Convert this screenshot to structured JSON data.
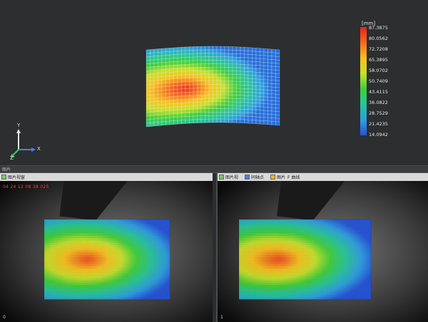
{
  "colorbar": {
    "unit": "[mm]",
    "ticks": [
      "87.3875",
      "80.0562",
      "72.7208",
      "65.3895",
      "58.0702",
      "50.7409",
      "43.4115",
      "36.0822",
      "28.7529",
      "21.4235",
      "14.0942"
    ],
    "gradient_colors": [
      "#e8231b",
      "#f26a1f",
      "#f7c21f",
      "#c8e02a",
      "#3fcf3a",
      "#27c59a",
      "#2d9fe0",
      "#2453d8"
    ]
  },
  "axis_triad": {
    "x_label": "X",
    "y_label": "Y",
    "z_label": "Z",
    "x_color": "#4a7cff",
    "y_color": "#e8e8e8",
    "z_color": "#2fd05a"
  },
  "divider": {
    "title": "图片"
  },
  "camera_left": {
    "toolbar": [
      {
        "icon": "image-icon",
        "label": "图片视窗"
      }
    ],
    "timestamp": "04 24 12 08 38 025",
    "frame_index": "0"
  },
  "camera_right": {
    "toolbar": [
      {
        "icon": "image-icon",
        "label": "图片视"
      },
      {
        "icon": "grid-icon",
        "label": "同轴点"
      },
      {
        "icon": "picture-icon",
        "label": "图片"
      },
      {
        "icon": "curve-icon",
        "label": "F 曲线"
      }
    ],
    "frame_index": "1"
  }
}
